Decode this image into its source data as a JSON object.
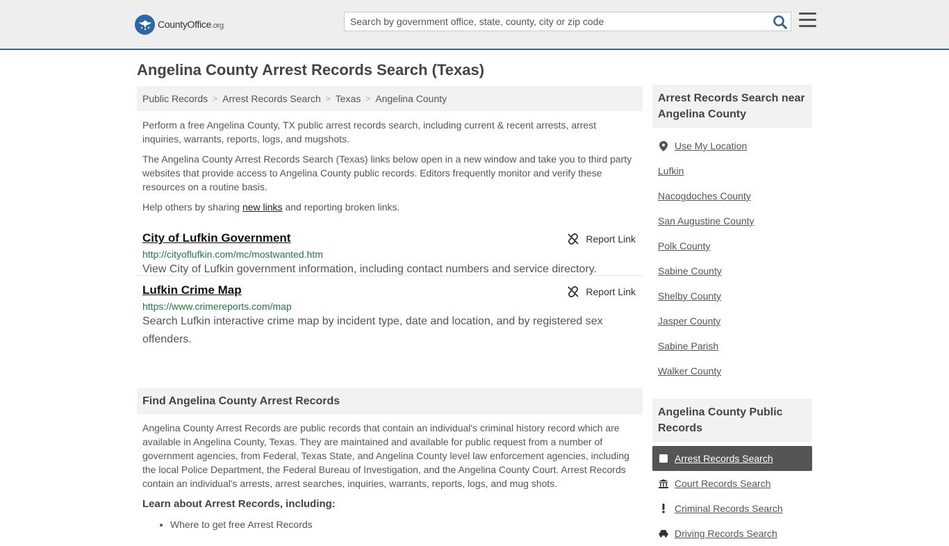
{
  "header": {
    "logo_main": "CountyOffice",
    "logo_suffix": ".org",
    "search_placeholder": "Search by government office, state, county, city or zip code"
  },
  "page": {
    "title": "Angelina County Arrest Records Search (Texas)"
  },
  "breadcrumb": [
    "Public Records",
    "Arrest Records Search",
    "Texas",
    "Angelina County"
  ],
  "intro": {
    "p1": "Perform a free Angelina County, TX public arrest records search, including current & recent arrests, arrest inquiries, warrants, reports, logs, and mugshots.",
    "p2": "The Angelina County Arrest Records Search (Texas) links below open in a new window and take you to third party websites that provide access to Angelina County public records. Editors frequently monitor and verify these resources on a routine basis.",
    "p3_before": "Help others by sharing ",
    "p3_link": "new links",
    "p3_after": " and reporting broken links."
  },
  "links": [
    {
      "title": "City of Lufkin Government",
      "url": "http://cityoflufkin.com/mc/mostwanted.htm",
      "desc": "View City of Lufkin government information, including contact numbers and service directory.",
      "report": "Report Link"
    },
    {
      "title": "Lufkin Crime Map",
      "url": "https://www.crimereports.com/map",
      "desc": "Search Lufkin interactive crime map by incident type, date and location, and by registered sex offenders.",
      "report": "Report Link"
    }
  ],
  "find": {
    "heading": "Find Angelina County Arrest Records",
    "body": "Angelina County Arrest Records are public records that contain an individual's criminal history record which are available in Angelina County, Texas. They are maintained and available for public request from a number of government agencies, from Federal, Texas State, and Angelina County level law enforcement agencies, including the local Police Department, the Federal Bureau of Investigation, and the Angelina County Court. Arrest Records contain an individual's arrests, arrest searches, inquiries, warrants, reports, logs, and mug shots.",
    "learn": "Learn about Arrest Records, including:",
    "bullets": [
      "Where to get free Arrest Records"
    ]
  },
  "sidebar": {
    "near_heading": "Arrest Records Search near Angelina County",
    "use_location": "Use My Location",
    "near": [
      "Lufkin",
      "Nacogdoches County",
      "San Augustine County",
      "Polk County",
      "Sabine County",
      "Shelby County",
      "Jasper County",
      "Sabine Parish",
      "Walker County"
    ],
    "public_heading": "Angelina County Public Records",
    "public": [
      "Arrest Records Search",
      "Court Records Search",
      "Criminal Records Search",
      "Driving Records Search"
    ]
  }
}
